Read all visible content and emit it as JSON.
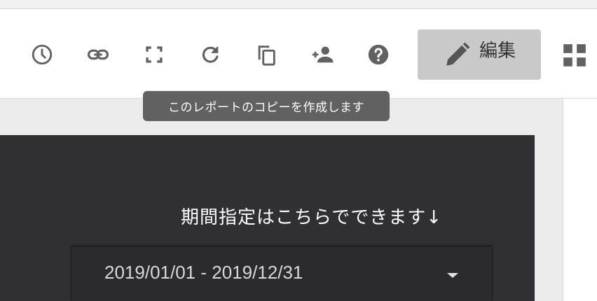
{
  "toolbar": {
    "icons": [
      {
        "name": "history-icon"
      },
      {
        "name": "link-icon"
      },
      {
        "name": "fullscreen-icon"
      },
      {
        "name": "refresh-icon"
      },
      {
        "name": "copy-icon"
      },
      {
        "name": "share-person-icon"
      },
      {
        "name": "help-icon"
      }
    ],
    "edit_label": "編集",
    "icon_color": "#616161"
  },
  "tooltip": {
    "text": "このレポートのコピーを作成します"
  },
  "report": {
    "period_note": "期間指定はこちらでできます↓",
    "date_range": "2019/01/01 - 2019/12/31",
    "background": "#303034"
  }
}
